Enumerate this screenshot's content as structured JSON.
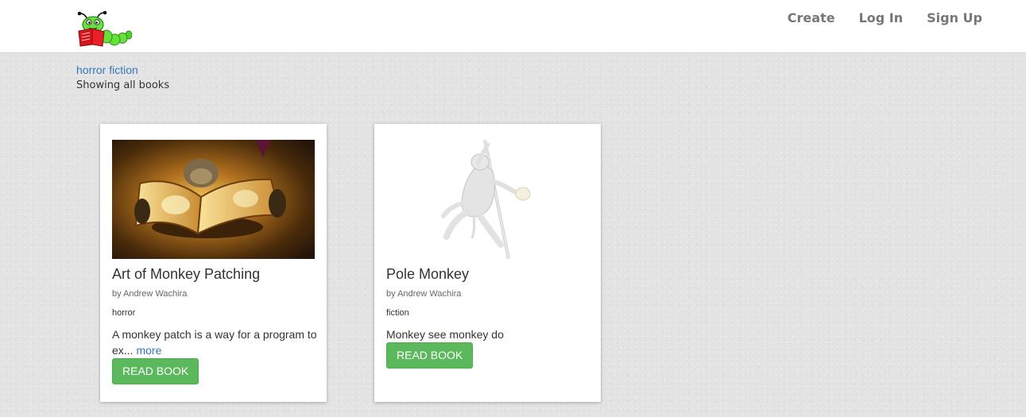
{
  "navbar": {
    "links": [
      {
        "label": "Create"
      },
      {
        "label": "Log In"
      },
      {
        "label": "Sign Up"
      }
    ]
  },
  "filter": {
    "tags_label": "horror fiction",
    "subtitle": "Showing all books"
  },
  "books": [
    {
      "title": "Art of Monkey Patching",
      "author": "by Andrew Wachira",
      "genre": "horror",
      "description": "A monkey patch is a way for a program to ex...",
      "more_label": "more",
      "button_label": "READ BOOK"
    },
    {
      "title": "Pole Monkey",
      "author": "by Andrew Wachira",
      "genre": "fiction",
      "description": "Monkey see monkey do",
      "button_label": "READ BOOK"
    }
  ],
  "colors": {
    "link": "#337ab7",
    "button_green": "#5cb85c",
    "nav_text": "#777777",
    "page_background": "#e3e3e3"
  },
  "icons": {
    "logo": "bookworm-logo-icon"
  }
}
